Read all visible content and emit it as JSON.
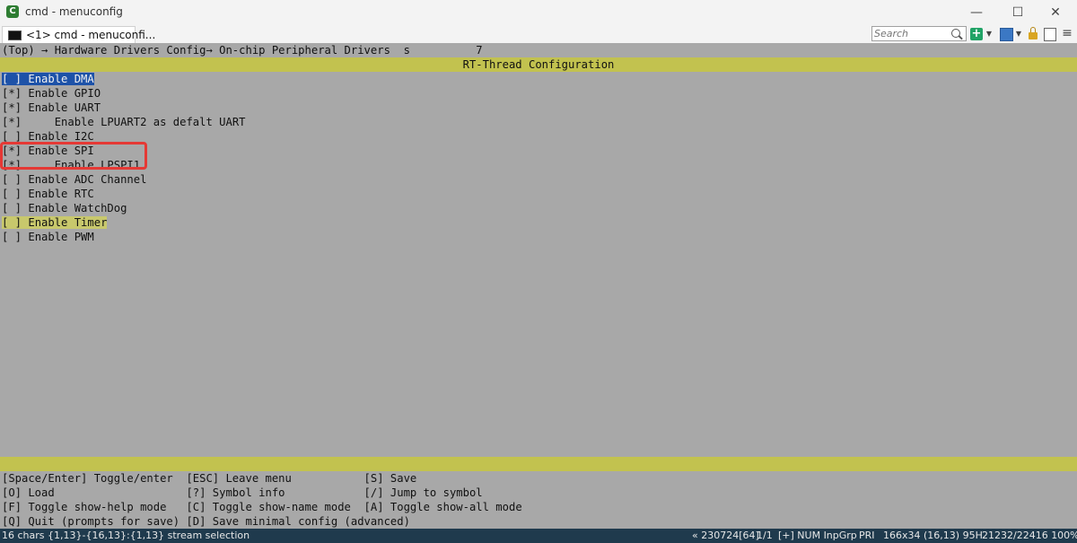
{
  "window": {
    "title": "cmd - menuconfig",
    "app_icon": "conemu-icon",
    "controls": [
      "—",
      "☐",
      "✕"
    ]
  },
  "tab": {
    "label": "<1> cmd - menuconfi..."
  },
  "toolbar": {
    "search_placeholder": "Search"
  },
  "terminal": {
    "breadcrumb": "(Top) → Hardware Drivers Config→ On-chip Peripheral Drivers  s          7",
    "banner_title": "RT-Thread Configuration",
    "menu_items": [
      {
        "check": "[ ]",
        "label": "Enable DMA"
      },
      {
        "check": "[*]",
        "label": "Enable GPIO"
      },
      {
        "check": "[*]",
        "label": "Enable UART"
      },
      {
        "check": "[*]",
        "label": "    Enable LPUART2 as defalt UART"
      },
      {
        "check": "[ ]",
        "label": "Enable I2C"
      },
      {
        "check": "[*]",
        "label": "Enable SPI"
      },
      {
        "check": "[*]",
        "label": "    Enable LPSPI1"
      },
      {
        "check": "[ ]",
        "label": "Enable ADC Channel"
      },
      {
        "check": "[ ]",
        "label": "Enable RTC"
      },
      {
        "check": "[ ]",
        "label": "Enable WatchDog"
      },
      {
        "check": "[ ]",
        "label": "Enable Timer"
      },
      {
        "check": "[ ]",
        "label": "Enable PWM"
      }
    ],
    "help": [
      "[Space/Enter] Toggle/enter  [ESC] Leave menu           [S] Save",
      "[O] Load                    [?] Symbol info            [/] Jump to symbol",
      "[F] Toggle show-help mode   [C] Toggle show-name mode  [A] Toggle show-all mode",
      "[Q] Quit (prompts for save) [D] Save minimal config (advanced)"
    ]
  },
  "statusbar": {
    "selection": "16 chars {1,13}-{16,13}:{1,13} stream selection",
    "buffer": "« 230724[64]",
    "page": "1/1",
    "modes": "[+] NUM InpGrp",
    "priority": "PRI",
    "size": "166x34",
    "cursor": "(16,13) 95H",
    "memory": "21232/22416 100%"
  }
}
